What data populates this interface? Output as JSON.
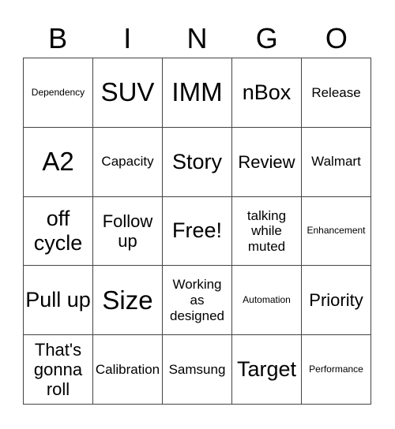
{
  "header": [
    "B",
    "I",
    "N",
    "G",
    "O"
  ],
  "cells": [
    {
      "text": "Dependency",
      "size": "s-xs"
    },
    {
      "text": "SUV",
      "size": "s-xl"
    },
    {
      "text": "IMM",
      "size": "s-xl"
    },
    {
      "text": "nBox",
      "size": "s-l"
    },
    {
      "text": "Release",
      "size": "s-s"
    },
    {
      "text": "A2",
      "size": "s-xl"
    },
    {
      "text": "Capacity",
      "size": "s-s"
    },
    {
      "text": "Story",
      "size": "s-l"
    },
    {
      "text": "Review",
      "size": "s-m"
    },
    {
      "text": "Walmart",
      "size": "s-s"
    },
    {
      "text": "off cycle",
      "size": "s-l"
    },
    {
      "text": "Follow up",
      "size": "s-m"
    },
    {
      "text": "Free!",
      "size": "s-l"
    },
    {
      "text": "talking while muted",
      "size": "s-s"
    },
    {
      "text": "Enhancement",
      "size": "s-xs"
    },
    {
      "text": "Pull up",
      "size": "s-l"
    },
    {
      "text": "Size",
      "size": "s-xl"
    },
    {
      "text": "Working as designed",
      "size": "s-s"
    },
    {
      "text": "Automation",
      "size": "s-xs"
    },
    {
      "text": "Priority",
      "size": "s-m"
    },
    {
      "text": "That's gonna roll",
      "size": "s-m"
    },
    {
      "text": "Calibration",
      "size": "s-s"
    },
    {
      "text": "Samsung",
      "size": "s-s"
    },
    {
      "text": "Target",
      "size": "s-l"
    },
    {
      "text": "Performance",
      "size": "s-xs"
    }
  ]
}
